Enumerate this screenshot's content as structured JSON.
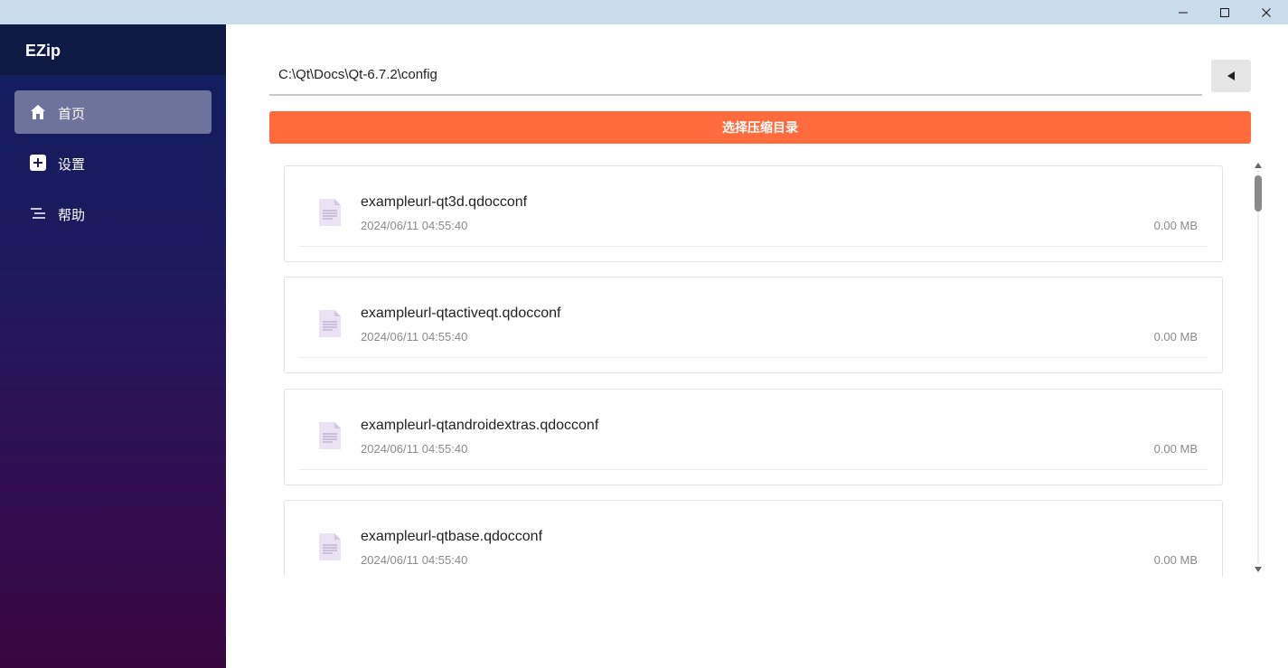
{
  "window": {
    "minimize_glyph": "—",
    "maximize_glyph": "☐",
    "close_glyph": "✕"
  },
  "sidebar": {
    "app_title": "EZip",
    "items": [
      {
        "label": "首页",
        "icon": "home-icon",
        "active": true
      },
      {
        "label": "设置",
        "icon": "plus-square-icon",
        "active": false
      },
      {
        "label": "帮助",
        "icon": "list-indent-icon",
        "active": false
      }
    ]
  },
  "main": {
    "path": "C:\\Qt\\Docs\\Qt-6.7.2\\config",
    "back_glyph": "◀",
    "select_button_label": "选择压缩目录",
    "files": [
      {
        "name": "exampleurl-qt3d.qdocconf",
        "date": "2024/06/11 04:55:40",
        "size": "0.00 MB"
      },
      {
        "name": "exampleurl-qtactiveqt.qdocconf",
        "date": "2024/06/11 04:55:40",
        "size": "0.00 MB"
      },
      {
        "name": "exampleurl-qtandroidextras.qdocconf",
        "date": "2024/06/11 04:55:40",
        "size": "0.00 MB"
      },
      {
        "name": "exampleurl-qtbase.qdocconf",
        "date": "2024/06/11 04:55:40",
        "size": "0.00 MB"
      }
    ]
  },
  "colors": {
    "accent": "#ff6b3d",
    "sidebar_top": "#101f5e",
    "sidebar_bottom": "#3a0640",
    "titlebar": "#c9dcec"
  }
}
